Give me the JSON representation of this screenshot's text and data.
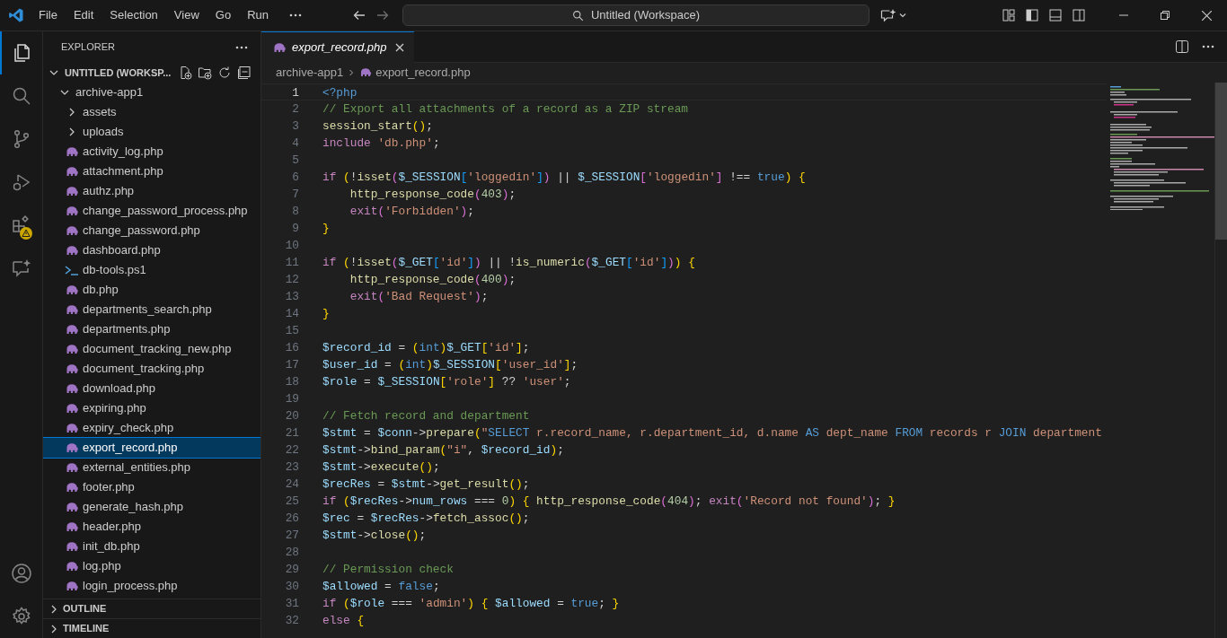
{
  "menu": [
    "File",
    "Edit",
    "Selection",
    "View",
    "Go",
    "Run"
  ],
  "command_center": {
    "value": "Untitled (Workspace)"
  },
  "code": [
    {
      "n": "1",
      "active": true,
      "tokens": [
        {
          "kind": "keyword",
          "t": "<?php"
        }
      ]
    },
    {
      "n": "2",
      "active": false,
      "tokens": [
        {
          "kind": "comment",
          "t": "// Export all attachments of a record as a ZIP stream"
        }
      ]
    },
    {
      "n": "3",
      "active": false,
      "tokens": [
        {
          "kind": "function",
          "t": "session_start"
        },
        {
          "kind": "bracket1",
          "t": "()"
        },
        {
          "kind": "plain",
          "t": ";"
        }
      ]
    },
    {
      "n": "4",
      "active": false,
      "tokens": [
        {
          "kind": "control",
          "t": "include "
        },
        {
          "kind": "string",
          "t": "'db.php'"
        },
        {
          "kind": "plain",
          "t": ";"
        }
      ]
    },
    {
      "n": "5",
      "active": false
    },
    {
      "n": "6",
      "active": false,
      "tokens": [
        {
          "kind": "control",
          "t": "if "
        },
        {
          "kind": "bracket1",
          "t": "("
        },
        {
          "kind": "plain",
          "t": "!"
        },
        {
          "kind": "function",
          "t": "isset"
        },
        {
          "kind": "bracket2",
          "t": "("
        },
        {
          "kind": "variable",
          "t": "$_SESSION"
        },
        {
          "kind": "bracket3",
          "t": "["
        },
        {
          "kind": "string",
          "t": "'loggedin'"
        },
        {
          "kind": "bracket3",
          "t": "]"
        },
        {
          "kind": "bracket2",
          "t": ")"
        },
        {
          "kind": "plain",
          "t": " || "
        },
        {
          "kind": "variable",
          "t": "$_SESSION"
        },
        {
          "kind": "bracket2",
          "t": "["
        },
        {
          "kind": "string",
          "t": "'loggedin'"
        },
        {
          "kind": "bracket2",
          "t": "]"
        },
        {
          "kind": "plain",
          "t": " !== "
        },
        {
          "kind": "keyword",
          "t": "true"
        },
        {
          "kind": "bracket1",
          "t": ") {"
        }
      ]
    },
    {
      "n": "7",
      "active": false,
      "tokens": [
        {
          "kind": "function",
          "t": "    http_response_code"
        },
        {
          "kind": "bracket2",
          "t": "("
        },
        {
          "kind": "number",
          "t": "403"
        },
        {
          "kind": "bracket2",
          "t": ")"
        },
        {
          "kind": "plain",
          "t": ";"
        }
      ]
    },
    {
      "n": "8",
      "active": false,
      "tokens": [
        {
          "kind": "control",
          "t": "    exit"
        },
        {
          "kind": "bracket2",
          "t": "("
        },
        {
          "kind": "string",
          "t": "'Forbidden'"
        },
        {
          "kind": "bracket2",
          "t": ")"
        },
        {
          "kind": "plain",
          "t": ";"
        }
      ]
    },
    {
      "n": "9",
      "active": false,
      "tokens": [
        {
          "kind": "bracket1",
          "t": "}"
        }
      ]
    },
    {
      "n": "10",
      "active": false
    },
    {
      "n": "11",
      "active": false,
      "tokens": [
        {
          "kind": "control",
          "t": "if "
        },
        {
          "kind": "bracket1",
          "t": "("
        },
        {
          "kind": "plain",
          "t": "!"
        },
        {
          "kind": "function",
          "t": "isset"
        },
        {
          "kind": "bracket2",
          "t": "("
        },
        {
          "kind": "variable",
          "t": "$_GET"
        },
        {
          "kind": "bracket3",
          "t": "["
        },
        {
          "kind": "string",
          "t": "'id'"
        },
        {
          "kind": "bracket3",
          "t": "]"
        },
        {
          "kind": "bracket2",
          "t": ")"
        },
        {
          "kind": "plain",
          "t": " || !"
        },
        {
          "kind": "function",
          "t": "is_numeric"
        },
        {
          "kind": "bracket2",
          "t": "("
        },
        {
          "kind": "variable",
          "t": "$_GET"
        },
        {
          "kind": "bracket3",
          "t": "["
        },
        {
          "kind": "string",
          "t": "'id'"
        },
        {
          "kind": "bracket3",
          "t": "]"
        },
        {
          "kind": "bracket2",
          "t": ")"
        },
        {
          "kind": "bracket1",
          "t": ") {"
        }
      ]
    },
    {
      "n": "12",
      "active": false,
      "tokens": [
        {
          "kind": "function",
          "t": "    http_response_code"
        },
        {
          "kind": "bracket2",
          "t": "("
        },
        {
          "kind": "number",
          "t": "400"
        },
        {
          "kind": "bracket2",
          "t": ")"
        },
        {
          "kind": "plain",
          "t": ";"
        }
      ]
    },
    {
      "n": "13",
      "active": false,
      "tokens": [
        {
          "kind": "control",
          "t": "    exit"
        },
        {
          "kind": "bracket2",
          "t": "("
        },
        {
          "kind": "string",
          "t": "'Bad Request'"
        },
        {
          "kind": "bracket2",
          "t": ")"
        },
        {
          "kind": "plain",
          "t": ";"
        }
      ]
    },
    {
      "n": "14",
      "active": false,
      "tokens": [
        {
          "kind": "bracket1",
          "t": "}"
        }
      ]
    },
    {
      "n": "15",
      "active": false
    },
    {
      "n": "16",
      "active": false,
      "tokens": [
        {
          "kind": "variable",
          "t": "$record_id"
        },
        {
          "kind": "plain",
          "t": " = "
        },
        {
          "kind": "bracket1",
          "t": "("
        },
        {
          "kind": "keyword",
          "t": "int"
        },
        {
          "kind": "bracket1",
          "t": ")"
        },
        {
          "kind": "variable",
          "t": "$_GET"
        },
        {
          "kind": "bracket1",
          "t": "["
        },
        {
          "kind": "string",
          "t": "'id'"
        },
        {
          "kind": "bracket1",
          "t": "]"
        },
        {
          "kind": "plain",
          "t": ";"
        }
      ]
    },
    {
      "n": "17",
      "active": false,
      "tokens": [
        {
          "kind": "variable",
          "t": "$user_id"
        },
        {
          "kind": "plain",
          "t": " = "
        },
        {
          "kind": "bracket1",
          "t": "("
        },
        {
          "kind": "keyword",
          "t": "int"
        },
        {
          "kind": "bracket1",
          "t": ")"
        },
        {
          "kind": "variable",
          "t": "$_SESSION"
        },
        {
          "kind": "bracket1",
          "t": "["
        },
        {
          "kind": "string",
          "t": "'user_id'"
        },
        {
          "kind": "bracket1",
          "t": "]"
        },
        {
          "kind": "plain",
          "t": ";"
        }
      ]
    },
    {
      "n": "18",
      "active": false,
      "tokens": [
        {
          "kind": "variable",
          "t": "$role"
        },
        {
          "kind": "plain",
          "t": " = "
        },
        {
          "kind": "variable",
          "t": "$_SESSION"
        },
        {
          "kind": "bracket1",
          "t": "["
        },
        {
          "kind": "string",
          "t": "'role'"
        },
        {
          "kind": "bracket1",
          "t": "]"
        },
        {
          "kind": "plain",
          "t": " ?? "
        },
        {
          "kind": "string",
          "t": "'user'"
        },
        {
          "kind": "plain",
          "t": ";"
        }
      ]
    },
    {
      "n": "19",
      "active": false
    },
    {
      "n": "20",
      "active": false,
      "tokens": [
        {
          "kind": "comment",
          "t": "// Fetch record and department"
        }
      ]
    },
    {
      "n": "21",
      "active": false,
      "tokens": [
        {
          "kind": "variable",
          "t": "$stmt"
        },
        {
          "kind": "plain",
          "t": " = "
        },
        {
          "kind": "variable",
          "t": "$conn"
        },
        {
          "kind": "plain",
          "t": "->"
        },
        {
          "kind": "function",
          "t": "prepare"
        },
        {
          "kind": "bracket1",
          "t": "("
        },
        {
          "kind": "string",
          "t": "\""
        },
        {
          "kind": "keyword",
          "t": "SELECT"
        },
        {
          "kind": "string",
          "t": " r.record_name, r.department_id, d.name "
        },
        {
          "kind": "keyword",
          "t": "AS"
        },
        {
          "kind": "string",
          "t": " dept_name "
        },
        {
          "kind": "keyword",
          "t": "FROM"
        },
        {
          "kind": "string",
          "t": " records r "
        },
        {
          "kind": "keyword",
          "t": "JOIN"
        },
        {
          "kind": "string",
          "t": " department"
        }
      ]
    },
    {
      "n": "22",
      "active": false,
      "tokens": [
        {
          "kind": "variable",
          "t": "$stmt"
        },
        {
          "kind": "plain",
          "t": "->"
        },
        {
          "kind": "function",
          "t": "bind_param"
        },
        {
          "kind": "bracket1",
          "t": "("
        },
        {
          "kind": "string",
          "t": "\"i\""
        },
        {
          "kind": "plain",
          "t": ", "
        },
        {
          "kind": "variable",
          "t": "$record_id"
        },
        {
          "kind": "bracket1",
          "t": ")"
        },
        {
          "kind": "plain",
          "t": ";"
        }
      ]
    },
    {
      "n": "23",
      "active": false,
      "tokens": [
        {
          "kind": "variable",
          "t": "$stmt"
        },
        {
          "kind": "plain",
          "t": "->"
        },
        {
          "kind": "function",
          "t": "execute"
        },
        {
          "kind": "bracket1",
          "t": "()"
        },
        {
          "kind": "plain",
          "t": ";"
        }
      ]
    },
    {
      "n": "24",
      "active": false,
      "tokens": [
        {
          "kind": "variable",
          "t": "$recRes"
        },
        {
          "kind": "plain",
          "t": " = "
        },
        {
          "kind": "variable",
          "t": "$stmt"
        },
        {
          "kind": "plain",
          "t": "->"
        },
        {
          "kind": "function",
          "t": "get_result"
        },
        {
          "kind": "bracket1",
          "t": "()"
        },
        {
          "kind": "plain",
          "t": ";"
        }
      ]
    },
    {
      "n": "25",
      "active": false,
      "tokens": [
        {
          "kind": "control",
          "t": "if "
        },
        {
          "kind": "bracket1",
          "t": "("
        },
        {
          "kind": "variable",
          "t": "$recRes"
        },
        {
          "kind": "plain",
          "t": "->"
        },
        {
          "kind": "variable",
          "t": "num_rows"
        },
        {
          "kind": "plain",
          "t": " === "
        },
        {
          "kind": "number",
          "t": "0"
        },
        {
          "kind": "bracket1",
          "t": ") { "
        },
        {
          "kind": "function",
          "t": "http_response_code"
        },
        {
          "kind": "bracket2",
          "t": "("
        },
        {
          "kind": "number",
          "t": "404"
        },
        {
          "kind": "bracket2",
          "t": ")"
        },
        {
          "kind": "plain",
          "t": "; "
        },
        {
          "kind": "control",
          "t": "exit"
        },
        {
          "kind": "bracket2",
          "t": "("
        },
        {
          "kind": "string",
          "t": "'Record not found'"
        },
        {
          "kind": "bracket2",
          "t": ")"
        },
        {
          "kind": "plain",
          "t": "; "
        },
        {
          "kind": "bracket1",
          "t": "}"
        }
      ]
    },
    {
      "n": "26",
      "active": false,
      "tokens": [
        {
          "kind": "variable",
          "t": "$rec"
        },
        {
          "kind": "plain",
          "t": " = "
        },
        {
          "kind": "variable",
          "t": "$recRes"
        },
        {
          "kind": "plain",
          "t": "->"
        },
        {
          "kind": "function",
          "t": "fetch_assoc"
        },
        {
          "kind": "bracket1",
          "t": "()"
        },
        {
          "kind": "plain",
          "t": ";"
        }
      ]
    },
    {
      "n": "27",
      "active": false,
      "tokens": [
        {
          "kind": "variable",
          "t": "$stmt"
        },
        {
          "kind": "plain",
          "t": "->"
        },
        {
          "kind": "function",
          "t": "close"
        },
        {
          "kind": "bracket1",
          "t": "()"
        },
        {
          "kind": "plain",
          "t": ";"
        }
      ]
    },
    {
      "n": "28",
      "active": false
    },
    {
      "n": "29",
      "active": false,
      "tokens": [
        {
          "kind": "comment",
          "t": "// Permission check"
        }
      ]
    },
    {
      "n": "30",
      "active": false,
      "tokens": [
        {
          "kind": "variable",
          "t": "$allowed"
        },
        {
          "kind": "plain",
          "t": " = "
        },
        {
          "kind": "keyword",
          "t": "false"
        },
        {
          "kind": "plain",
          "t": ";"
        }
      ]
    },
    {
      "n": "31",
      "active": false,
      "tokens": [
        {
          "kind": "control",
          "t": "if "
        },
        {
          "kind": "bracket1",
          "t": "("
        },
        {
          "kind": "variable",
          "t": "$role"
        },
        {
          "kind": "plain",
          "t": " === "
        },
        {
          "kind": "string",
          "t": "'admin'"
        },
        {
          "kind": "bracket1",
          "t": ") { "
        },
        {
          "kind": "variable",
          "t": "$allowed"
        },
        {
          "kind": "plain",
          "t": " = "
        },
        {
          "kind": "keyword",
          "t": "true"
        },
        {
          "kind": "plain",
          "t": "; "
        },
        {
          "kind": "bracket1",
          "t": "}"
        }
      ]
    },
    {
      "n": "32",
      "active": false,
      "tokens": [
        {
          "kind": "control",
          "t": "else "
        },
        {
          "kind": "bracket1",
          "t": "{"
        }
      ]
    }
  ],
  "sidebar": {
    "title": "EXPLORER",
    "workspace": {
      "label": "UNTITLED (WORKSP...",
      "expanded": true
    },
    "tree": [
      {
        "label": "archive-app1",
        "kind": "folder",
        "expanded": true,
        "selected": false,
        "children": [
          {
            "label": "assets",
            "kind": "folder",
            "expanded": false,
            "selected": false
          },
          {
            "label": "uploads",
            "kind": "folder",
            "expanded": false,
            "selected": false
          },
          {
            "label": "activity_log.php",
            "kind": "php",
            "selected": false
          },
          {
            "label": "attachment.php",
            "kind": "php",
            "selected": false
          },
          {
            "label": "authz.php",
            "kind": "php",
            "selected": false
          },
          {
            "label": "change_password_process.php",
            "kind": "php",
            "selected": false
          },
          {
            "label": "change_password.php",
            "kind": "php",
            "selected": false
          },
          {
            "label": "dashboard.php",
            "kind": "php",
            "selected": false
          },
          {
            "label": "db-tools.ps1",
            "kind": "ps1",
            "selected": false
          },
          {
            "label": "db.php",
            "kind": "php",
            "selected": false
          },
          {
            "label": "departments_search.php",
            "kind": "php",
            "selected": false
          },
          {
            "label": "departments.php",
            "kind": "php",
            "selected": false
          },
          {
            "label": "document_tracking_new.php",
            "kind": "php",
            "selected": false
          },
          {
            "label": "document_tracking.php",
            "kind": "php",
            "selected": false
          },
          {
            "label": "download.php",
            "kind": "php",
            "selected": false
          },
          {
            "label": "expiring.php",
            "kind": "php",
            "selected": false
          },
          {
            "label": "expiry_check.php",
            "kind": "php",
            "selected": false
          },
          {
            "label": "export_record.php",
            "kind": "php",
            "selected": true
          },
          {
            "label": "external_entities.php",
            "kind": "php",
            "selected": false
          },
          {
            "label": "footer.php",
            "kind": "php",
            "selected": false
          },
          {
            "label": "generate_hash.php",
            "kind": "php",
            "selected": false
          },
          {
            "label": "header.php",
            "kind": "php",
            "selected": false
          },
          {
            "label": "init_db.php",
            "kind": "php",
            "selected": false
          },
          {
            "label": "log.php",
            "kind": "php",
            "selected": false
          },
          {
            "label": "login_process.php",
            "kind": "php",
            "selected": false
          }
        ]
      }
    ],
    "sections": [
      {
        "label": "OUTLINE",
        "expanded": false
      },
      {
        "label": "TIMELINE",
        "expanded": false
      }
    ]
  },
  "tabs": [
    {
      "label": "export_record.php",
      "selected": true
    }
  ],
  "breadcrumb": {
    "folder": "archive-app1",
    "file": "export_record.php"
  }
}
